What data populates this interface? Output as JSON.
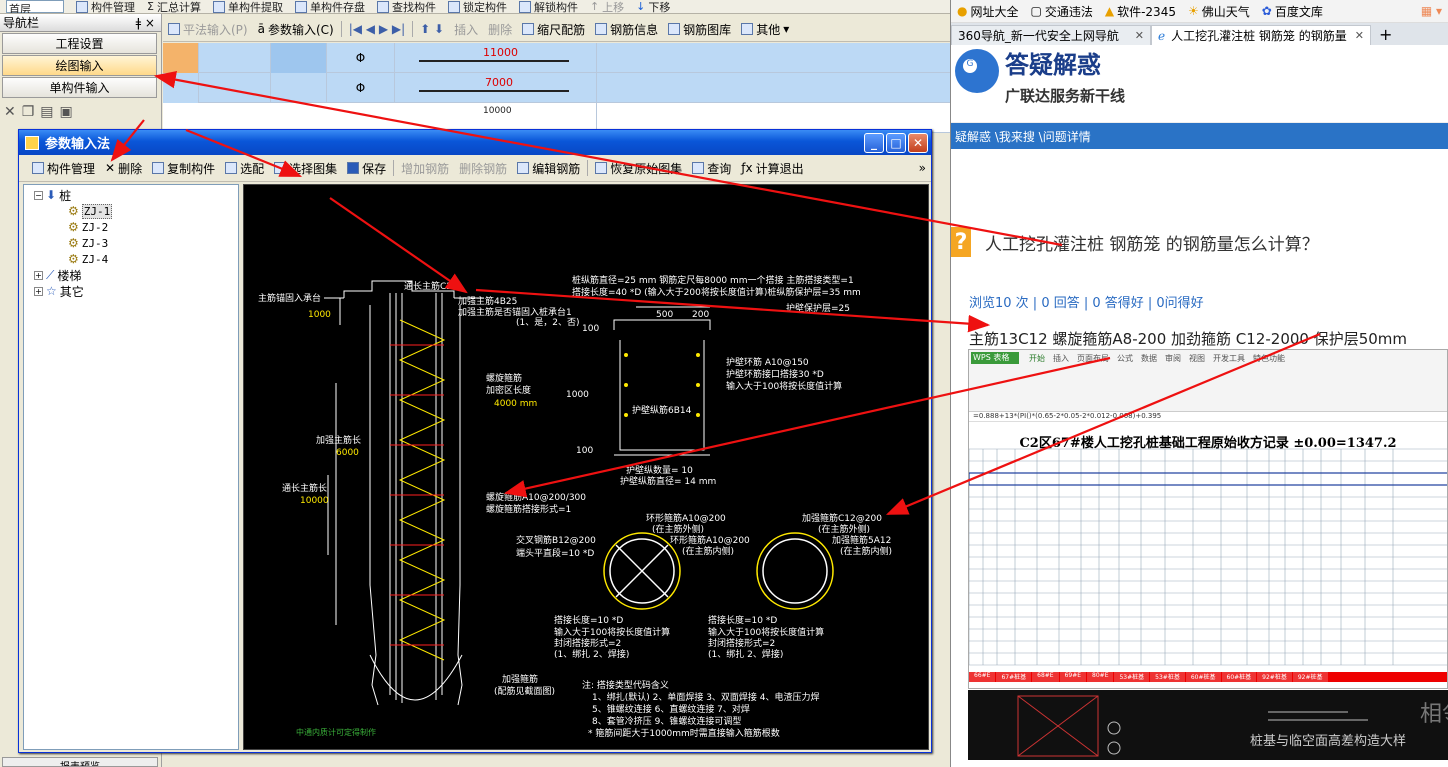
{
  "app": {
    "topbar": {
      "layer_combo": "首层",
      "items": [
        "构件管理",
        "汇总计算",
        "单构件提取",
        "单构件存盘",
        "查找构件",
        "锁定构件",
        "解锁构件",
        "上移",
        "下移"
      ]
    },
    "nav": {
      "title": "导航栏",
      "pin": "ǂ ×",
      "buttons": [
        "工程设置",
        "绘图输入",
        "单构件输入"
      ],
      "bottom": "报表预览"
    },
    "toolbar2": {
      "items": [
        "平法输入(P)",
        "参数输入(C)",
        "插入",
        "删除",
        "缩尺配筋",
        "钢筋信息",
        "钢筋图库",
        "其他"
      ]
    },
    "grid": {
      "rows": [
        {
          "grade": "Φ",
          "length": "11000"
        },
        {
          "grade": "Φ",
          "length": "7000"
        },
        {
          "grade": "",
          "length": "10000"
        }
      ]
    },
    "dialog": {
      "title": "参数输入法",
      "toolbar": [
        "构件管理",
        "删除",
        "复制构件",
        "选配",
        "选择图集",
        "保存",
        "增加钢筋",
        "删除钢筋",
        "编辑钢筋",
        "恢复原始图集",
        "查询",
        "计算退出"
      ],
      "more": "»",
      "tree": {
        "root": "桩",
        "items": [
          "ZJ-1",
          "ZJ-2",
          "ZJ-3",
          "ZJ-4"
        ],
        "others": [
          "楼梯",
          "其它"
        ]
      },
      "cad": {
        "longbar_top": "通长主筋C25",
        "anchor_label": "主筋锚固入承台",
        "anchor_value": "1000",
        "extra_main": "加强主筋4B25",
        "extra_anchor": "加强主筋是否锚固入桩承台1",
        "extra_anchor_opts": "(1、是，2、否)",
        "spiral_dense": "螺旋箍筋",
        "spiral_dense_len": "加密区长度",
        "spiral_dense_val": "4000  mm",
        "extra_len_label": "加强主筋长",
        "extra_len_val": "6000",
        "long_len_label": "通长主筋长",
        "long_len_val": "10000",
        "spec_line1": "桩纵筋直径=25 mm   钢筋定尺每8000 mm一个搭接   主筋搭接类型=1",
        "spec_line2": "搭接长度=40   *D (输入大于200将按长度值计算)桩纵筋保护层=35 mm",
        "spec_line3": "护壁保护层=25",
        "dim_top1": "500",
        "dim_top2": "200",
        "dim_left1": "100",
        "dim_left2": "1000",
        "dim_left3": "100",
        "wall_ring": "护壁环筋 A10@150",
        "wall_ring_lap": "护壁环筋接口搭接30  *D",
        "wall_ring_note": "输入大于100将按长度值计算",
        "wall_vertical": "护壁纵筋6B14",
        "wall_count": "护壁纵数量= 10",
        "wall_dia": "护壁纵筋直径= 14 mm",
        "spiral": "螺旋箍筋A10@200/300",
        "spiral_lap": "螺旋箍筋搭接形式=1",
        "cross": "交叉钢筋B12@200",
        "end_flat": "端头平直段=10 *D",
        "ring_out": "环形箍筋A10@200",
        "ring_out_note": "(在主筋外侧)",
        "ring_in": "环形箍筋A10@200",
        "ring_in_note": "(在主筋内侧)",
        "strengthen1": "加强箍筋C12@200",
        "strengthen1_note": "(在主筋外侧)",
        "strengthen2": "加强箍筋5A12",
        "strengthen2_note": "(在主筋内侧)",
        "lap1_a": "搭接长度=10 *D",
        "lap1_b": "输入大于100将按长度值计算",
        "lap1_c": "封闭搭接形式=2",
        "lap1_d": "(1、绑扎  2、焊接)",
        "lap2_a": "搭接长度=10 *D",
        "lap2_b": "输入大于100将按长度值计算",
        "lap2_c": "封闭搭接形式=2",
        "lap2_d": "(1、绑扎  2、焊接)",
        "strengthen_bottom": "加强箍筋",
        "strengthen_bottom_note": "(配筋见截面图)",
        "notes_title": "注:  搭接类型代码含义",
        "notes_1": "1、绑扎(默认)   2、单面焊接    3、双面焊接    4、电渣压力焊",
        "notes_2": "5、锥螺纹连接    6、直螺纹连接    7、对焊",
        "notes_3": "8、套管冷挤压    9、锥螺纹连接可调型",
        "notes_4": "* 箍筋间距大于1000mm时需直接输入箍筋根数",
        "watermark": "中通内质计可定得制作"
      }
    }
  },
  "browser": {
    "bookmarks": [
      "网址大全",
      "交通违法",
      "软件-2345",
      "佛山天气",
      "百度文库"
    ],
    "tabs": [
      {
        "label": "360导航_新一代安全上网导航",
        "active": false
      },
      {
        "label": "人工挖孔灌注桩 钢筋笼 的钢筋量",
        "active": true
      }
    ],
    "new_tab": "+",
    "site_title": "答疑解惑",
    "site_sub": "广联达服务新干线",
    "breadcrumb": "疑解惑 \\我来搜 \\问题详情",
    "question_mark": "?",
    "question": "人工挖孔灌注桩 钢筋笼 的钢筋量怎么计算？",
    "stats": "浏览10 次 | 0 回答 | 0 答得好 | 0问得好",
    "body": "主筋13C12  螺旋箍筋A8-200 加劲箍筋 C12-2000  保护层50mm",
    "sheet": {
      "logo": "WPS 表格",
      "tabs": [
        "开始",
        "插入",
        "页面布局",
        "公式",
        "数据",
        "审阅",
        "视图",
        "开发工具",
        "特色功能"
      ],
      "formula": "=0.888+13*(PI()*(0.65-2*0.05-2*0.012-0.008)+0.395",
      "title": "C2区67#楼人工挖孔桩基础工程原始收方记录    ±0.00=1347.2",
      "sheet_tabs": [
        "66#E",
        "67#桩基",
        "68#E",
        "69#E",
        "80#E",
        "53#桩基",
        "53#桩基",
        "60#桩基",
        "60#桩基",
        "92#桩基",
        "92#桩基"
      ]
    },
    "thumb_text": "桩基与临空面高差构造大样",
    "thumb_big": "相邻"
  }
}
